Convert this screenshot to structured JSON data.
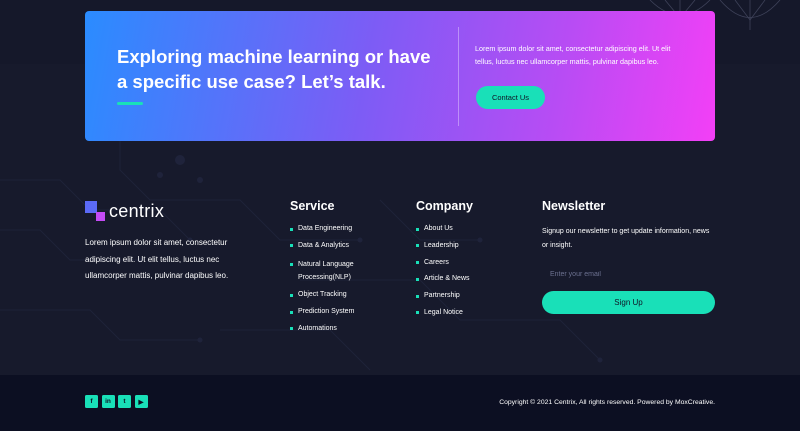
{
  "cta": {
    "title": "Exploring machine learning or have a specific use case? Let’s talk.",
    "text": "Lorem ipsum dolor sit amet, consectetur adipiscing elit. Ut elit tellus, luctus nec ullamcorper mattis, pulvinar dapibus leo.",
    "button_label": "Contact Us"
  },
  "brand": {
    "name": "centrix",
    "description": "Lorem ipsum dolor sit amet, consectetur adipiscing elit. Ut elit tellus, luctus nec ullamcorper mattis, pulvinar dapibus leo."
  },
  "service": {
    "title": "Service",
    "items": [
      "Data Engineering",
      "Data & Analytics",
      "Natural Language Processing(NLP)",
      "Object Tracking",
      "Prediction System",
      "Automations"
    ]
  },
  "company": {
    "title": "Company",
    "items": [
      "About Us",
      "Leadership",
      "Careers",
      "Article & News",
      "Partnership",
      "Legal Notice"
    ]
  },
  "newsletter": {
    "title": "Newsletter",
    "text": "Signup our newsletter to get update information, news or insight.",
    "email_placeholder": "Enter your email",
    "button_label": "Sign Up"
  },
  "footer": {
    "socials": [
      {
        "icon": "facebook-icon",
        "glyph": "f"
      },
      {
        "icon": "linkedin-icon",
        "glyph": "in"
      },
      {
        "icon": "twitter-icon",
        "glyph": "t"
      },
      {
        "icon": "youtube-icon",
        "glyph": "▶"
      }
    ],
    "copyright": "Copyright © 2021 Centrix, All rights reserved. Powered by MoxCreative."
  },
  "colors": {
    "accent": "#19e0b8",
    "background": "#171a2c",
    "footer_bar": "#0c0f22",
    "gradient_start": "#2a8cff",
    "gradient_end": "#f33ff6"
  }
}
